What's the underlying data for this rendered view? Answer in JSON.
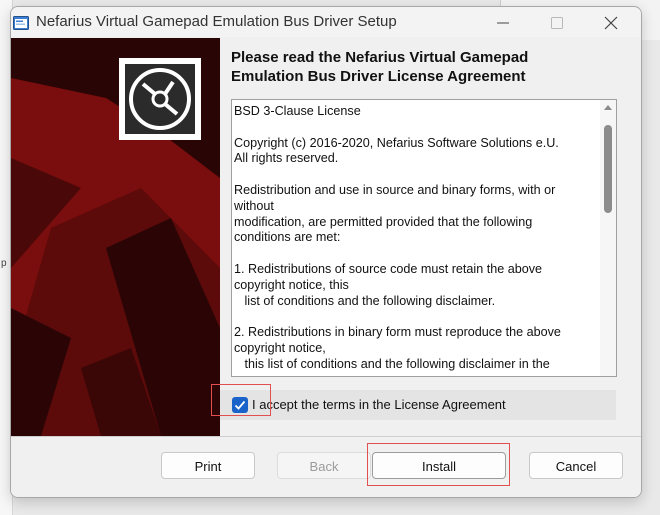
{
  "window": {
    "title": "Nefarius Virtual Gamepad Emulation Bus Driver Setup"
  },
  "heading": {
    "line1": "Please read the Nefarius Virtual Gamepad",
    "line2": "Emulation Bus Driver License Agreement"
  },
  "license": {
    "text": "BSD 3-Clause License\n\nCopyright (c) 2016-2020, Nefarius Software Solutions e.U.\nAll rights reserved.\n\nRedistribution and use in source and binary forms, with or\nwithout\nmodification, are permitted provided that the following\nconditions are met:\n\n1. Redistributions of source code must retain the above\ncopyright notice, this\n   list of conditions and the following disclaimer.\n\n2. Redistributions in binary form must reproduce the above\ncopyright notice,\n   this list of conditions and the following disclaimer in the"
  },
  "accept": {
    "label": "I accept the terms in the License Agreement",
    "checked": true
  },
  "buttons": {
    "print": "Print",
    "back": "Back",
    "install": "Install",
    "cancel": "Cancel"
  },
  "background": {
    "left_mark": "p"
  },
  "colors": {
    "banner": "#6a0b0b",
    "checkbox": "#1a64c9",
    "highlight": "#e05050"
  }
}
